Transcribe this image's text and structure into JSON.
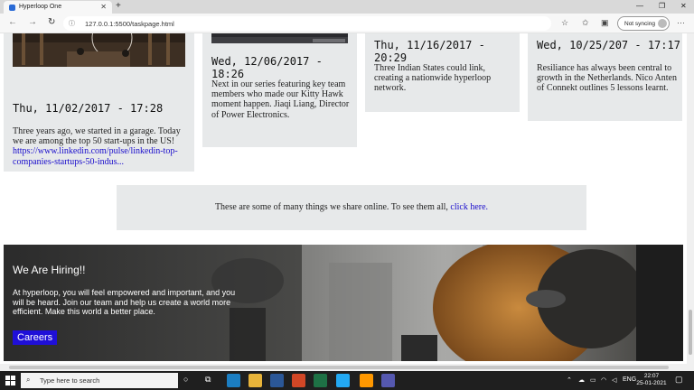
{
  "browser": {
    "tab_title": "Hyperloop One",
    "tab_close": "✕",
    "new_tab": "+",
    "url": "127.0.0.1:5500/taskpage.html",
    "sync_label": "Not syncing",
    "minimize": "—",
    "restore": "❐",
    "close": "✕",
    "back": "←",
    "forward": "→",
    "refresh": "↻",
    "info": "ⓘ",
    "more": "···"
  },
  "cards": [
    {
      "date": "Thu, 11/02/2017 - 17:28",
      "text": "Three years ago, we started in a garage. Today we are among the top 50 start-ups in the US!",
      "link": "https://www.linkedin.com/pulse/linkedin-top-companies-startups-50-indus..."
    },
    {
      "date": "Wed, 12/06/2017 - 18:26",
      "text": "Next in our series featuring key team members who made our Kitty Hawk moment happen. Jiaqi Liang, Director of Power Electronics."
    },
    {
      "date": "Thu, 11/16/2017 - 20:29",
      "text": "Three Indian States could link, creating a nationwide hyperloop network."
    },
    {
      "date": "Wed, 10/25/207 - 17:17",
      "text": "Resiliance has always been central to growth in the Netherlands. Nico Anten of Connekt outlines 5 lessons learnt."
    }
  ],
  "share": {
    "text": "These are some of many things we share online. To see them all, ",
    "link": "click here."
  },
  "hiring": {
    "title": "We Are Hiring!!",
    "text": "At hyperloop, you will feel empowered and important, and you will be heard. Join our team and help us create a world more efficient. Make this world a better place.",
    "button": "Careers"
  },
  "taskbar": {
    "search_placeholder": "Type here to search",
    "lang": "ENG",
    "time": "22:07",
    "date": "25-01-2021"
  }
}
